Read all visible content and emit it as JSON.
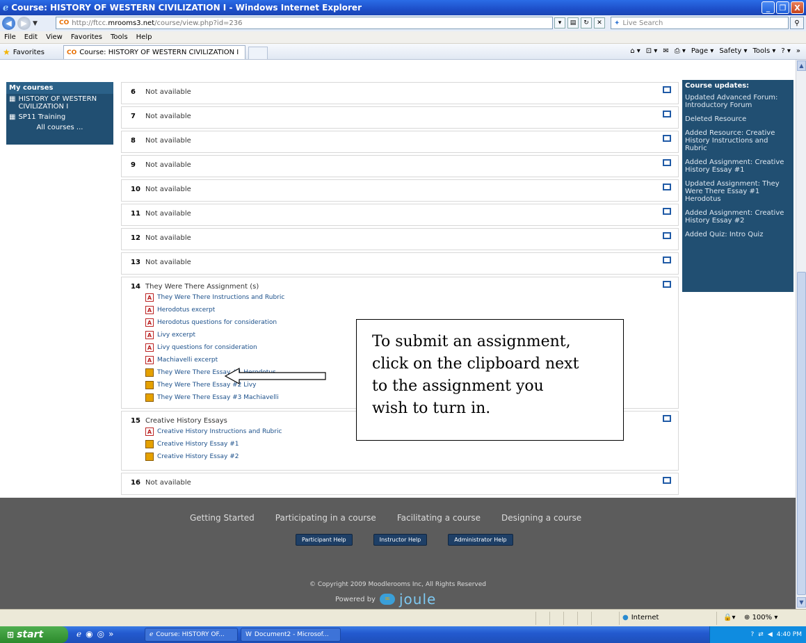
{
  "window": {
    "title": "Course: HISTORY OF WESTERN CIVILIZATION I - Windows Internet Explorer",
    "buttons": [
      "_",
      "❐",
      "X"
    ]
  },
  "address": {
    "url_prefix": "http://ftcc.",
    "url_host": "mrooms3.net",
    "url_path": "/course/view.php?id=236",
    "search_placeholder": "Live Search"
  },
  "menu": [
    "File",
    "Edit",
    "View",
    "Favorites",
    "Tools",
    "Help"
  ],
  "favbar": {
    "favorites": "Favorites",
    "tab_title": "Course: HISTORY OF WESTERN CIVILIZATION I",
    "commands": [
      "Page ▾",
      "Safety ▾",
      "Tools ▾"
    ]
  },
  "mycourses": {
    "header": "My courses",
    "courses": [
      "HISTORY OF WESTERN CIVILIZATION I",
      "SP11 Training"
    ],
    "all": "All courses ..."
  },
  "sections": [
    {
      "num": "6",
      "title": "Not available"
    },
    {
      "num": "7",
      "title": "Not available"
    },
    {
      "num": "8",
      "title": "Not available"
    },
    {
      "num": "9",
      "title": "Not available"
    },
    {
      "num": "10",
      "title": "Not available"
    },
    {
      "num": "11",
      "title": "Not available"
    },
    {
      "num": "12",
      "title": "Not available"
    },
    {
      "num": "13",
      "title": "Not available"
    },
    {
      "num": "14",
      "title": "They Were There Assignment (s)"
    },
    {
      "num": "15",
      "title": "Creative History Essays"
    },
    {
      "num": "16",
      "title": "Not available"
    }
  ],
  "sec14_items": [
    {
      "type": "pdf",
      "label": "They Were There Instructions and Rubric"
    },
    {
      "type": "pdf",
      "label": "Herodotus excerpt"
    },
    {
      "type": "pdf",
      "label": "Herodotus questions for consideration"
    },
    {
      "type": "pdf",
      "label": "Livy excerpt"
    },
    {
      "type": "pdf",
      "label": "Livy questions for consideration"
    },
    {
      "type": "pdf",
      "label": "Machiavelli excerpt"
    },
    {
      "type": "assign",
      "label": "They Were There Essay #1 Herodotus"
    },
    {
      "type": "assign",
      "label": "They Were There Essay #2 Livy"
    },
    {
      "type": "assign",
      "label": "They Were There Essay #3 Machiavelli"
    }
  ],
  "sec15_items": [
    {
      "type": "pdf",
      "label": "Creative History Instructions and Rubric"
    },
    {
      "type": "assign",
      "label": "Creative History Essay #1"
    },
    {
      "type": "assign",
      "label": "Creative History Essay #2"
    }
  ],
  "updates": {
    "header": "Course updates:",
    "items": [
      "Updated Advanced Forum: Introductory Forum",
      "Deleted Resource",
      "Added Resource: Creative History Instructions and Rubric",
      "Added Assignment: Creative History Essay #1",
      "Updated Assignment: They Were There Essay #1 Herodotus",
      "Added Assignment: Creative History Essay #2",
      "Added Quiz: Intro Quiz"
    ]
  },
  "callout": {
    "lines": [
      "To submit an assignment,",
      "click on the clipboard next",
      "to the assignment you",
      "wish to turn in."
    ]
  },
  "footer": {
    "links": [
      "Getting Started",
      "Participating in a course",
      "Facilitating a course",
      "Designing a course"
    ],
    "help_buttons": [
      "Participant Help",
      "Instructor Help",
      "Administrator Help"
    ],
    "copyright": "© Copyright 2009 Moodlerooms Inc, All Rights Reserved",
    "powered": "Powered by",
    "logo": "joule"
  },
  "statusbar": {
    "zone": "Internet",
    "zoom": "100%"
  },
  "taskbar": {
    "start": "start",
    "tasks": [
      "Course: HISTORY OF...",
      "Document2 - Microsof..."
    ],
    "time": "4:40 PM"
  }
}
